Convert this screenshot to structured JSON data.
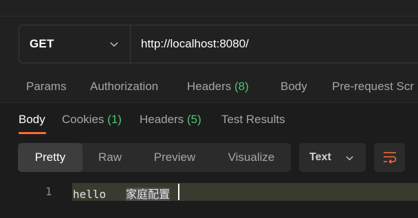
{
  "request": {
    "method": "GET",
    "url": "http://localhost:8080/"
  },
  "request_tabs": [
    {
      "label": "Params"
    },
    {
      "label": "Authorization"
    },
    {
      "label": "Headers",
      "count": "(8)"
    },
    {
      "label": "Body"
    },
    {
      "label": "Pre-request Scr"
    }
  ],
  "response_tabs": [
    {
      "label": "Body"
    },
    {
      "label": "Cookies",
      "count": "(1)"
    },
    {
      "label": "Headers",
      "count": "(5)"
    },
    {
      "label": "Test Results"
    }
  ],
  "view_modes": [
    "Pretty",
    "Raw",
    "Preview",
    "Visualize"
  ],
  "format": "Text",
  "response_body": {
    "line_number": "1",
    "text_part1": "hello",
    "text_part2": "家庭配置"
  },
  "colors": {
    "accent": "#ff6c37",
    "count_green": "#4ec770"
  }
}
